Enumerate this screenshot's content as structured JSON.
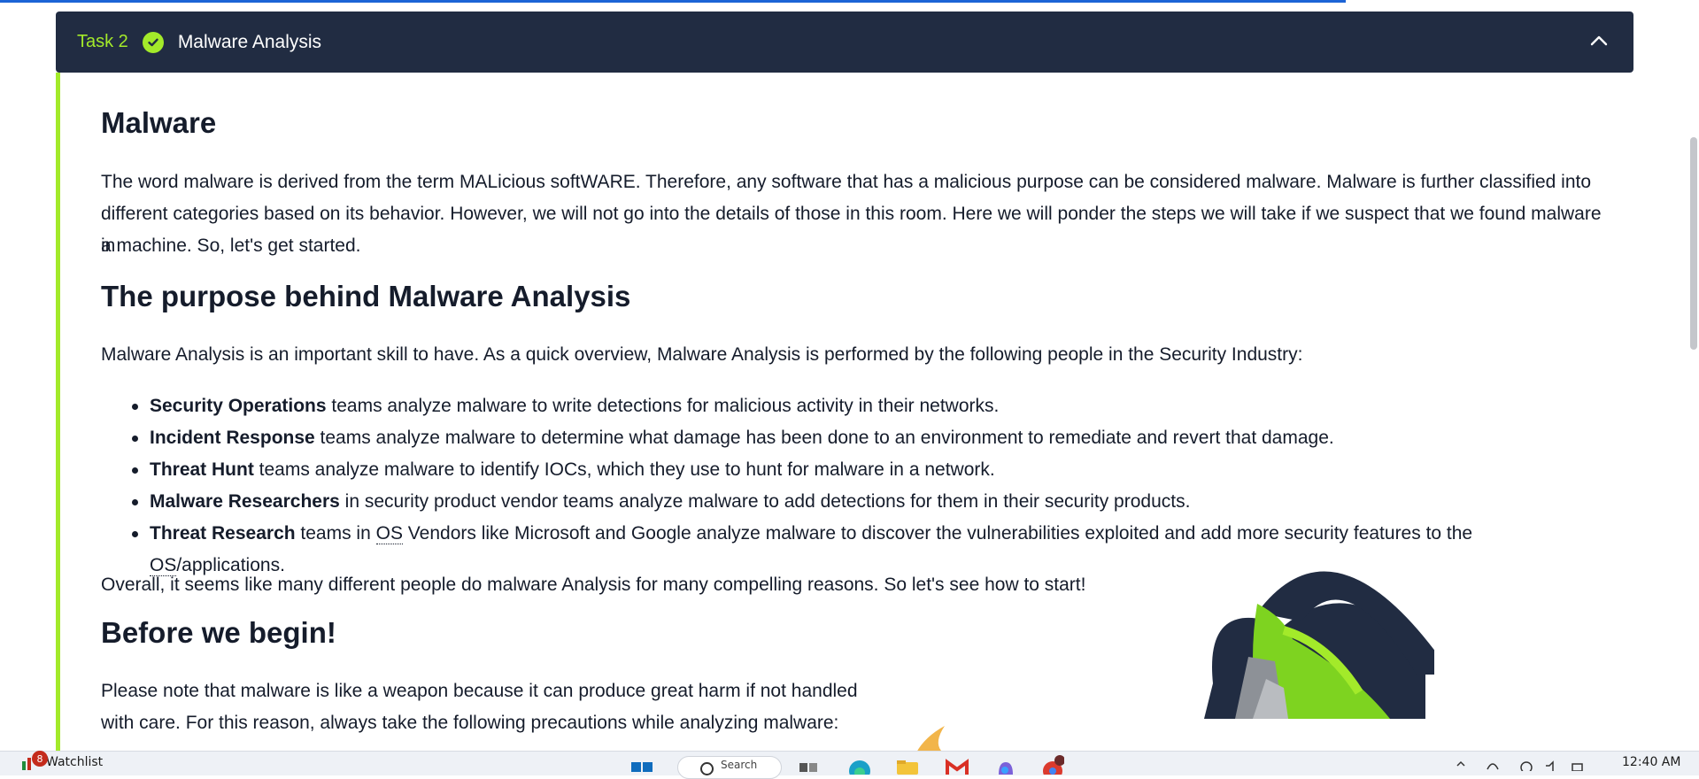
{
  "task": {
    "number": "Task 2",
    "title": "Malware Analysis",
    "status_icon": "check-circle-icon",
    "toggle_icon": "chevron-up-icon",
    "accent_color": "#a3ea2a",
    "header_color": "#212c42"
  },
  "sections": {
    "malware": {
      "heading": "Malware",
      "para_lines": [
        "The word malware is derived from the term MALicious softWARE. Therefore, any software that has a malicious purpose can be considered malware. Malware is further classified into",
        "different categories based on its behavior. However, we will not go into the details of those in this room. Here we will ponder the steps we will take if we suspect that we found malware in",
        "a machine. So, let's get started."
      ]
    },
    "purpose": {
      "heading": "The purpose behind Malware Analysis",
      "intro": "Malware Analysis is an important skill to have. As a quick overview, Malware Analysis is performed by the following people in the Security Industry:",
      "items": [
        {
          "bold": "Security Operations",
          "text": " teams analyze malware to write detections for malicious activity in their networks."
        },
        {
          "bold": "Incident Response",
          "text": " teams analyze malware to determine what damage has been done to an environment to remediate and revert that damage."
        },
        {
          "bold": "Threat Hunt",
          "text": " teams analyze malware to identify IOCs, which they use to hunt for malware in a network."
        },
        {
          "bold": "Malware Researchers",
          "text": " in security product vendor teams analyze malware to add detections for them in their security products."
        },
        {
          "bold": "Threat Research",
          "pre": " teams in ",
          "abbr1": "OS",
          "mid": " Vendors like Microsoft and Google analyze malware to discover the vulnerabilities exploited and add more security features to the ",
          "abbr2": "OS",
          "post": "/applications."
        }
      ],
      "outro": "Overall, it seems like many different people do malware Analysis for many compelling reasons. So let's see how to start!"
    },
    "begin": {
      "heading": "Before we begin!",
      "para_lines": [
        "Please note that malware is like a weapon because it can produce great harm if not handled",
        "with care. For this reason, always take the following precautions while analyzing malware:"
      ]
    }
  },
  "taskbar": {
    "watchlist_label": "Watchlist",
    "watchlist_badge": "8",
    "search_label": "Search",
    "clock": "12:40 AM"
  }
}
